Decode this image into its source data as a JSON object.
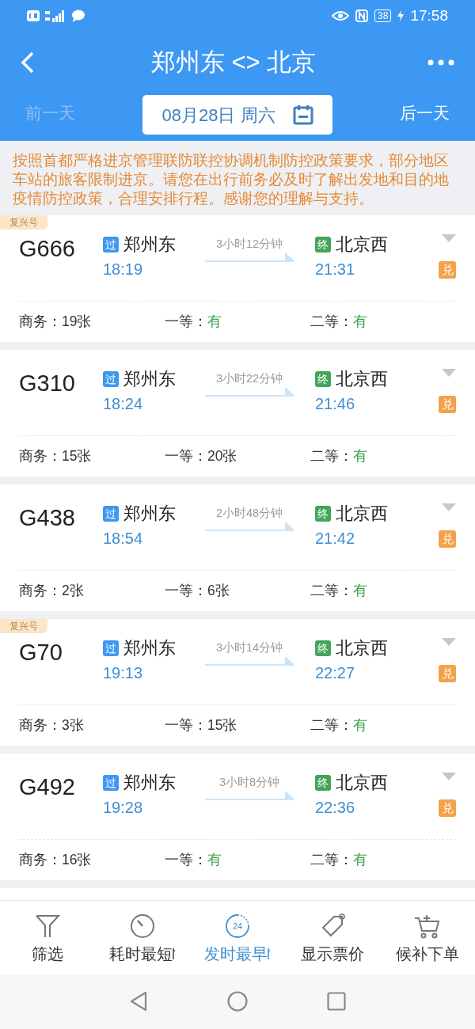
{
  "status_bar": {
    "time": "17:58",
    "battery": "38"
  },
  "header": {
    "title": "郑州东 <> 北京"
  },
  "date_bar": {
    "prev": {
      "label": "前一天",
      "disabled": true
    },
    "date": "08月28日 周六",
    "next": {
      "label": "后一天",
      "disabled": false
    }
  },
  "notice": "按照首都严格进京管理联防联控协调机制防控政策要求，部分地区车站的旅客限制进京。请您在出行前务必及时了解出发地和目的地疫情防控政策，合理安排行程。感谢您的理解与支持。",
  "trains": [
    {
      "tag": "复兴号",
      "number": "G666",
      "from": {
        "mark": "过",
        "station": "郑州东",
        "time": "18:19"
      },
      "duration": "3小时12分钟",
      "to": {
        "mark": "终",
        "station": "北京西",
        "time": "21:31"
      },
      "badge": "兑",
      "seats": [
        {
          "label": "商务：",
          "value": "19张",
          "plenty": false
        },
        {
          "label": "一等：",
          "value": "有",
          "plenty": true
        },
        {
          "label": "二等：",
          "value": "有",
          "plenty": true
        }
      ]
    },
    {
      "number": "G310",
      "from": {
        "mark": "过",
        "station": "郑州东",
        "time": "18:24"
      },
      "duration": "3小时22分钟",
      "to": {
        "mark": "终",
        "station": "北京西",
        "time": "21:46"
      },
      "badge": "兑",
      "seats": [
        {
          "label": "商务：",
          "value": "15张",
          "plenty": false
        },
        {
          "label": "一等：",
          "value": "20张",
          "plenty": false
        },
        {
          "label": "二等：",
          "value": "有",
          "plenty": true
        }
      ]
    },
    {
      "number": "G438",
      "from": {
        "mark": "过",
        "station": "郑州东",
        "time": "18:54"
      },
      "duration": "2小时48分钟",
      "to": {
        "mark": "终",
        "station": "北京西",
        "time": "21:42"
      },
      "badge": "兑",
      "seats": [
        {
          "label": "商务：",
          "value": "2张",
          "plenty": false
        },
        {
          "label": "一等：",
          "value": "6张",
          "plenty": false
        },
        {
          "label": "二等：",
          "value": "有",
          "plenty": true
        }
      ]
    },
    {
      "tag": "复兴号",
      "number": "G70",
      "from": {
        "mark": "过",
        "station": "郑州东",
        "time": "19:13"
      },
      "duration": "3小时14分钟",
      "to": {
        "mark": "终",
        "station": "北京西",
        "time": "22:27"
      },
      "badge": "兑",
      "seats": [
        {
          "label": "商务：",
          "value": "3张",
          "plenty": false
        },
        {
          "label": "一等：",
          "value": "15张",
          "plenty": false
        },
        {
          "label": "二等：",
          "value": "有",
          "plenty": true
        }
      ]
    },
    {
      "number": "G492",
      "from": {
        "mark": "过",
        "station": "郑州东",
        "time": "19:28"
      },
      "duration": "3小时8分钟",
      "to": {
        "mark": "终",
        "station": "北京西",
        "time": "22:36"
      },
      "badge": "兑",
      "seats": [
        {
          "label": "商务：",
          "value": "16张",
          "plenty": false
        },
        {
          "label": "一等：",
          "value": "有",
          "plenty": true
        },
        {
          "label": "二等：",
          "value": "有",
          "plenty": true
        }
      ]
    }
  ],
  "toolbar": [
    {
      "kind": "filter",
      "label": "筛选",
      "selected": false
    },
    {
      "kind": "duration",
      "label": "耗时最短",
      "selected": false,
      "sort_mark": true
    },
    {
      "kind": "departure",
      "label": "发时最早",
      "selected": true,
      "sort_mark": true,
      "icon_text": "24"
    },
    {
      "kind": "price",
      "label": "显示票价",
      "selected": false
    },
    {
      "kind": "waitlist",
      "label": "候补下单",
      "selected": false
    }
  ]
}
